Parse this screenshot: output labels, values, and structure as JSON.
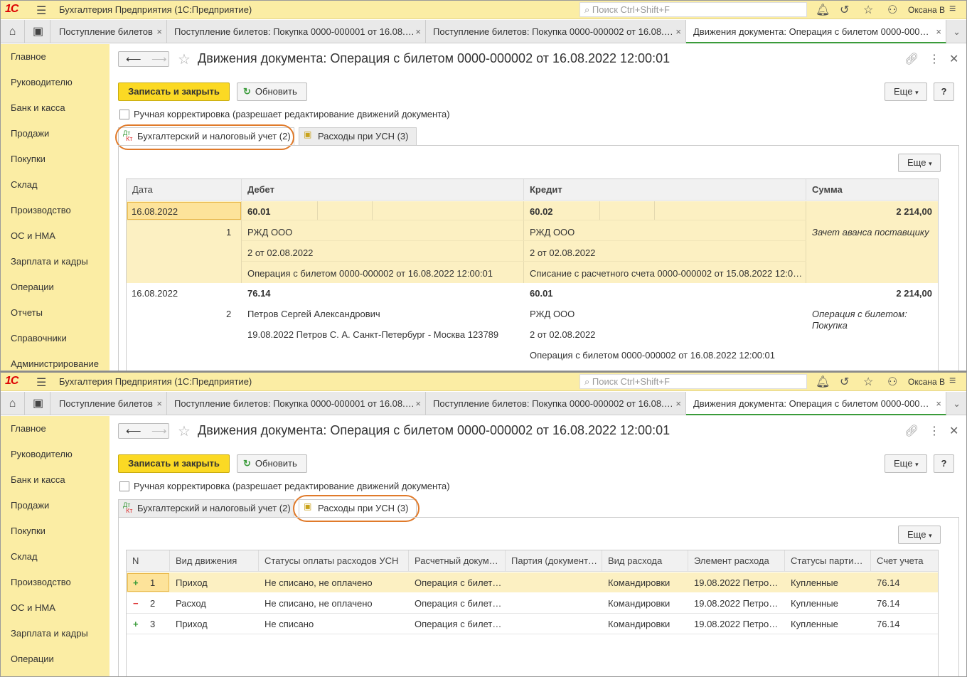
{
  "app": {
    "logo": "1С",
    "title": "Бухгалтерия Предприятия  (1С:Предприятие)",
    "search_placeholder": "Поиск Ctrl+Shift+F",
    "user": "Оксана В"
  },
  "tabs": [
    {
      "label": "Поступление билетов"
    },
    {
      "label": "Поступление билетов: Покупка 0000-000001 от 16.08.…"
    },
    {
      "label": "Поступление билетов: Покупка 0000-000002 от 16.08.…"
    },
    {
      "label": "Движения документа: Операция с билетом 0000-000…"
    }
  ],
  "sidebar": {
    "items": [
      "Главное",
      "Руководителю",
      "Банк и касса",
      "Продажи",
      "Покупки",
      "Склад",
      "Производство",
      "ОС и НМА",
      "Зарплата и кадры",
      "Операции",
      "Отчеты",
      "Справочники",
      "Администрирование"
    ]
  },
  "document": {
    "title": "Движения документа: Операция с билетом 0000-000002 от 16.08.2022 12:00:01",
    "save_close": "Записать и закрыть",
    "refresh": "Обновить",
    "more": "Еще",
    "help": "?",
    "manual_edit": "Ручная корректировка (разрешает редактирование движений документа)",
    "tab_accounting": "Бухгалтерский и налоговый учет (2)",
    "tab_usn": "Расходы при УСН (3)",
    "dt": "Дт",
    "kt": "Кт"
  },
  "accounting_table": {
    "headers": [
      "Дата",
      "Дебет",
      "Кредит",
      "Сумма"
    ],
    "rows": [
      {
        "date": "16.08.2022",
        "n": "1",
        "debit_account": "60.01",
        "credit_account": "60.02",
        "sum": "2 214,00",
        "debit_lines": [
          "РЖД ООО",
          "2 от 02.08.2022",
          "Операция с билетом 0000-000002 от 16.08.2022 12:00:01"
        ],
        "credit_lines": [
          "РЖД ООО",
          "2 от 02.08.2022",
          "Списание с расчетного счета 0000-000002 от 15.08.2022 12:0…"
        ],
        "note": "Зачет аванса поставщику"
      },
      {
        "date": "16.08.2022",
        "n": "2",
        "debit_account": "76.14",
        "credit_account": "60.01",
        "sum": "2 214,00",
        "debit_lines": [
          "Петров Сергей Александрович",
          "19.08.2022 Петров С. А. Санкт-Петербург - Москва 123789"
        ],
        "credit_lines": [
          "РЖД ООО",
          "2 от 02.08.2022",
          "Операция с билетом 0000-000002 от 16.08.2022 12:00:01"
        ],
        "note_line1": "Операция с билетом:",
        "note_line2": "Покупка"
      }
    ]
  },
  "usn_table": {
    "headers": [
      "N",
      "Вид движения",
      "Статусы оплаты расходов УСН",
      "Расчетный докум…",
      "Партия (документ…",
      "Вид расхода",
      "Элемент расхода",
      "Статусы парти…",
      "Счет учета"
    ],
    "rows": [
      {
        "sign": "+",
        "n": "1",
        "movement": "Приход",
        "status": "Не списано, не оплачено",
        "doc": "Операция с билет…",
        "batch": "",
        "expense_type": "Командировки",
        "element": "19.08.2022 Петро…",
        "batch_status": "Купленные",
        "account": "76.14"
      },
      {
        "sign": "−",
        "n": "2",
        "movement": "Расход",
        "status": "Не списано, не оплачено",
        "doc": "Операция с билет…",
        "batch": "",
        "expense_type": "Командировки",
        "element": "19.08.2022 Петро…",
        "batch_status": "Купленные",
        "account": "76.14"
      },
      {
        "sign": "+",
        "n": "3",
        "movement": "Приход",
        "status": "Не списано",
        "doc": "Операция с билет…",
        "batch": "",
        "expense_type": "Командировки",
        "element": "19.08.2022 Петро…",
        "batch_status": "Купленные",
        "account": "76.14"
      }
    ]
  },
  "colors": {
    "accent_yellow": "#fbd924",
    "sidebar_bg": "#fbeda4",
    "highlight_orange": "#e07a2a",
    "plus_green": "#3a9b3a",
    "minus_red": "#d33"
  }
}
